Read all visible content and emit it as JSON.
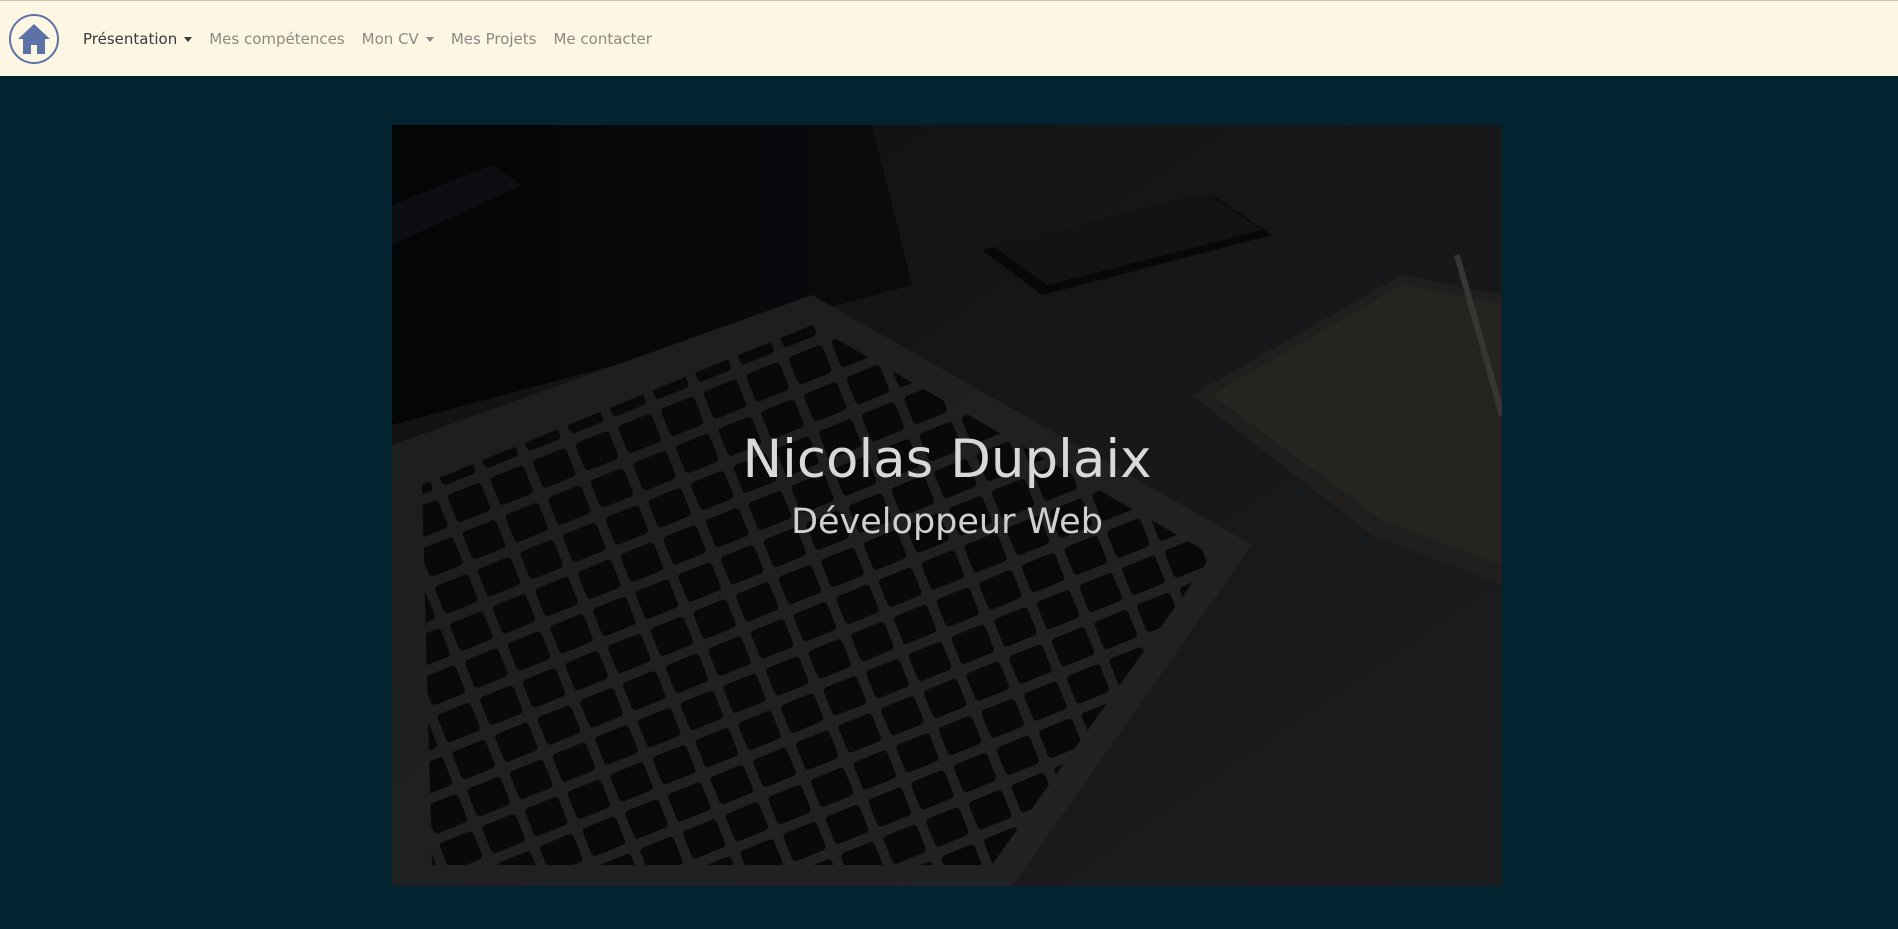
{
  "navbar": {
    "logo_icon": "home-icon",
    "items": [
      {
        "label": "Présentation",
        "dropdown": true,
        "active": true
      },
      {
        "label": "Mes compétences",
        "dropdown": false,
        "active": false
      },
      {
        "label": "Mon CV",
        "dropdown": true,
        "active": false
      },
      {
        "label": "Mes Projets",
        "dropdown": false,
        "active": false
      },
      {
        "label": "Me contacter",
        "dropdown": false,
        "active": false
      }
    ]
  },
  "hero": {
    "name": "Nicolas Duplaix",
    "subtitle": "Développeur Web",
    "background_image": "laptop-keyboard-photo"
  },
  "colors": {
    "navbar_bg": "#fdf6e3",
    "page_bg": "#022330",
    "logo_accent": "#5d73a8",
    "nav_text": "#8d8a85",
    "nav_text_active": "#3a3a3a"
  }
}
